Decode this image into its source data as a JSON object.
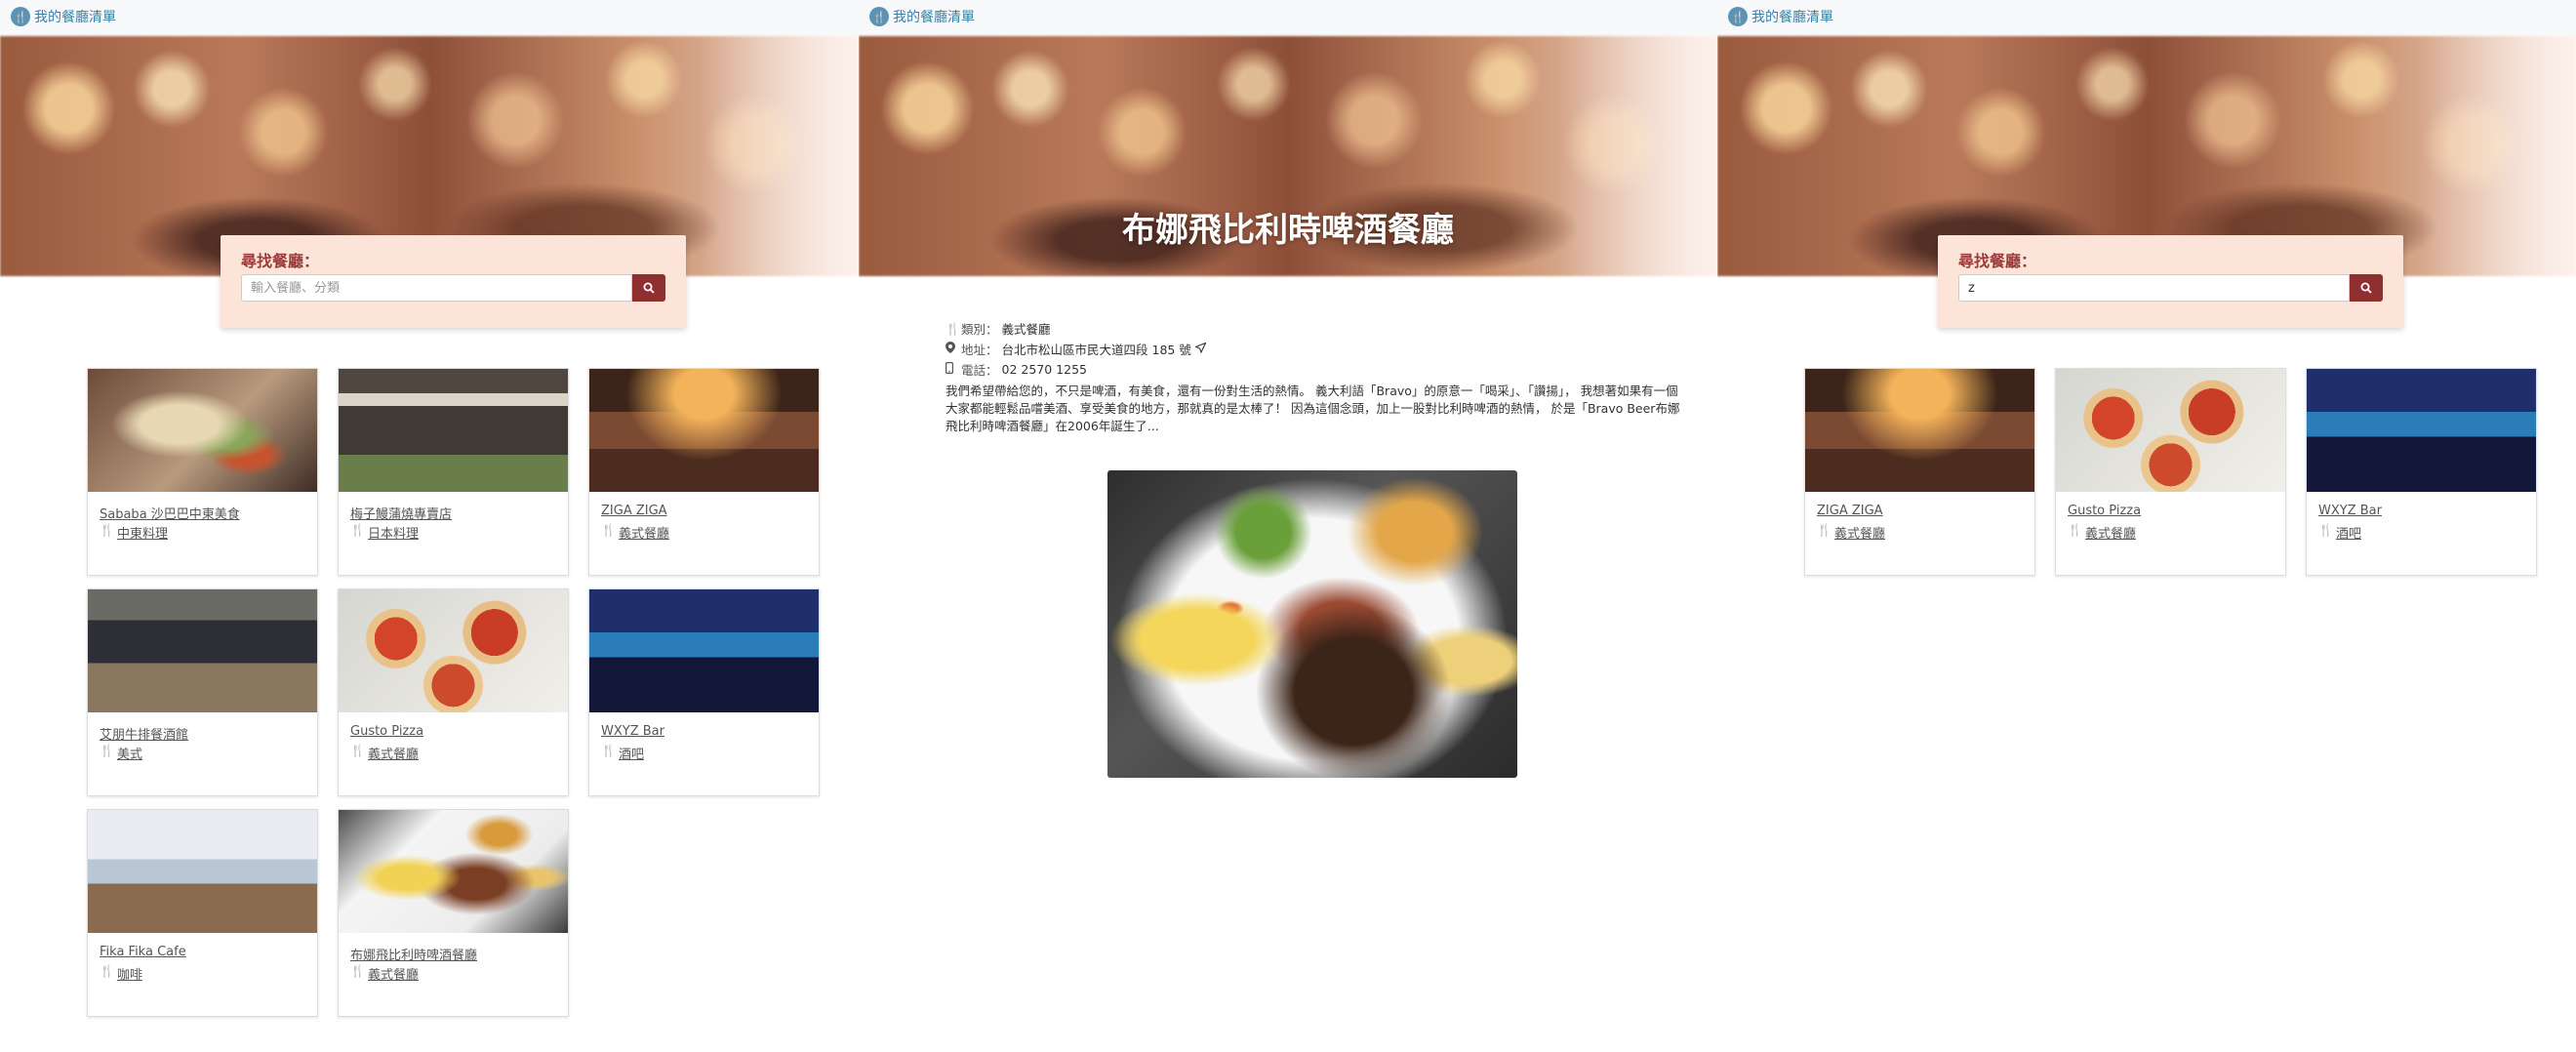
{
  "brand": {
    "label": "我的餐廳清單"
  },
  "search": {
    "title": "尋找餐廳：",
    "placeholder": "輸入餐廳、分類",
    "query_value": "z"
  },
  "restaurants": [
    {
      "name": "Sababa 沙巴巴中東美食",
      "category": "中東料理"
    },
    {
      "name": "梅子鰻蒲燒專賣店",
      "category": "日本料理"
    },
    {
      "name": "ZIGA ZIGA",
      "category": "義式餐廳"
    },
    {
      "name": "艾朋牛排餐酒館",
      "category": "美式"
    },
    {
      "name": "Gusto Pizza",
      "category": "義式餐廳"
    },
    {
      "name": "WXYZ Bar",
      "category": "酒吧"
    },
    {
      "name": "Fika Fika Cafe",
      "category": "咖啡"
    },
    {
      "name": "布娜飛比利時啤酒餐廳",
      "category": "義式餐廳"
    }
  ],
  "search_results": [
    {
      "name": "ZIGA ZIGA",
      "category": "義式餐廳"
    },
    {
      "name": "Gusto Pizza",
      "category": "義式餐廳"
    },
    {
      "name": "WXYZ Bar",
      "category": "酒吧"
    }
  ],
  "detail": {
    "title": "布娜飛比利時啤酒餐廳",
    "category_label": "類別：",
    "category_value": "義式餐廳",
    "address_label": "地址：",
    "address_value": "台北市松山區市民大道四段 185 號",
    "phone_label": "電話：",
    "phone_value": "02 2570 1255",
    "description": "我們希望帶給您的，不只是啤酒，有美食，還有一份對生活的熱情。 義大利語「Bravo」的原意一「喝采」、「讚揚」， 我想著如果有一個大家都能輕鬆品嚐美酒、享受美食的地方，那就真的是太棒了！ 因為這個念頭，加上一股對比利時啤酒的熱情， 於是「Bravo Beer布娜飛比利時啤酒餐廳」在2006年誕生了..."
  },
  "icons": {
    "utensils": "utensils-icon",
    "map_marker": "map-marker-icon",
    "phone": "phone-icon",
    "search": "search-icon",
    "location_arrow": "location-arrow-icon"
  },
  "colors": {
    "accent": "#8f2f2f",
    "search_panel": "#fde4d9",
    "brand": "#3a7fa3",
    "navbar": "#f8f9fa"
  }
}
